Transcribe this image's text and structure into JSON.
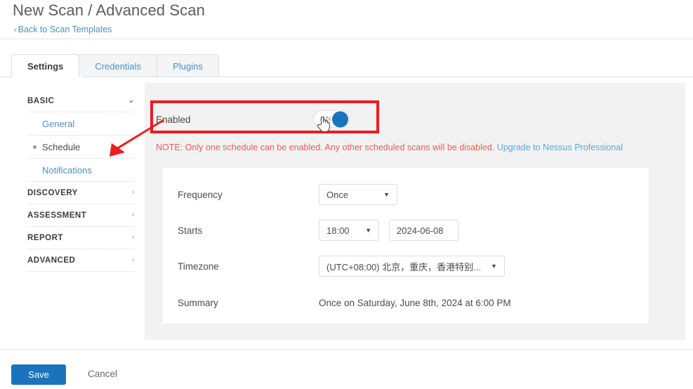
{
  "header": {
    "title": "New Scan / Advanced Scan",
    "back_link": "Back to Scan Templates",
    "back_chevron": "‹"
  },
  "tabs": [
    {
      "label": "Settings",
      "active": true
    },
    {
      "label": "Credentials",
      "active": false
    },
    {
      "label": "Plugins",
      "active": false
    }
  ],
  "sidebar": {
    "groups": [
      {
        "label": "BASIC",
        "caret": "⌄",
        "expanded": true
      },
      {
        "label": "DISCOVERY",
        "caret": "›",
        "expanded": false
      },
      {
        "label": "ASSESSMENT",
        "caret": "›",
        "expanded": false
      },
      {
        "label": "REPORT",
        "caret": "›",
        "expanded": false
      },
      {
        "label": "ADVANCED",
        "caret": "›",
        "expanded": false
      }
    ],
    "basic_items": [
      {
        "label": "General",
        "current": false
      },
      {
        "label": "Schedule",
        "current": true
      },
      {
        "label": "Notifications",
        "current": false
      }
    ]
  },
  "schedule": {
    "enabled_label": "Enabled",
    "toggle_state": "ON",
    "note_text": "NOTE: Only one schedule can be enabled. Any other scheduled scans will be disabled.",
    "note_link": "Upgrade to Nessus Professional",
    "rows": {
      "frequency_label": "Frequency",
      "frequency_value": "Once",
      "starts_label": "Starts",
      "starts_time": "18:00",
      "starts_date": "2024-06-08",
      "timezone_label": "Timezone",
      "timezone_value": "(UTC+08:00) 北京，重庆，香港特别...",
      "summary_label": "Summary",
      "summary_value": "Once on Saturday, June 8th, 2024 at 6:00 PM"
    },
    "caret_glyph": "▼"
  },
  "footer": {
    "save_label": "Save",
    "cancel_label": "Cancel"
  },
  "colors": {
    "accent_blue": "#1b74bb",
    "link_blue": "#4a90c4",
    "note_red": "#ef5a5a",
    "annotation_red": "#ee1c1c",
    "panel_gray": "#f2f2f2"
  }
}
